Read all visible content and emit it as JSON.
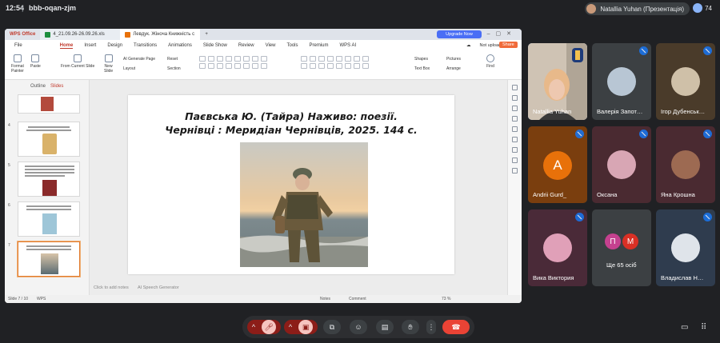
{
  "meet": {
    "time": "12:54",
    "separator": "|",
    "meeting_code": "bbb-oqan-zjm",
    "presenter_label": "Natallia Yuhan (Презентація)",
    "participant_count": "74"
  },
  "wps": {
    "tabs": [
      "WPS Office",
      "4_21.09.26-26.09.26.xls",
      "Левдук. Жіноча Книжність с"
    ],
    "tab_add": "+",
    "upgrade": "Upgrade Now",
    "menu": [
      "File",
      "Home",
      "Insert",
      "Design",
      "Transitions",
      "Animations",
      "Slide Show",
      "Review",
      "View",
      "Tools",
      "Premium",
      "WPS AI"
    ],
    "not_uploaded": "Not uploaded",
    "share": "Share",
    "ribbon": {
      "format_painter": "Format\nPainter",
      "paste": "Paste",
      "from_current": "From Current Slide",
      "new_slide": "New\nSlide",
      "ai_page": "AI Generate Page",
      "layout": "Layout",
      "reset": "Reset",
      "section": "Section",
      "shapes": "Shapes",
      "text_box": "Text Box",
      "pictures": "Pictures",
      "arrange": "Arrange",
      "find": "Find"
    },
    "panel_tabs": [
      "Outline",
      "Slides"
    ],
    "thumbs": [
      {
        "num": "",
        "lines": 0
      },
      {
        "num": "4",
        "lines": 3
      },
      {
        "num": "5",
        "lines": 6
      },
      {
        "num": "6",
        "lines": 4
      },
      {
        "num": "7",
        "lines": 3
      }
    ],
    "slide_title_1": "Паєвська Ю. (Тайра) Наживо: поезії.",
    "slide_title_2": "Чернівці : Меридіан Чернівців, 2025. 144 с.",
    "notes_hint": "Click to add notes",
    "ai_speech": "AI Speech Generator",
    "status_slide": "Slide 7 / 10",
    "status_app": "WPS",
    "status_notes": "Notes",
    "status_comment": "Comment",
    "zoom": "73 %"
  },
  "participants": [
    {
      "name": "Natallia Yuhan",
      "bg": "#c3b6a8",
      "type": "video"
    },
    {
      "name": "Валерія Запот…",
      "bg": "#3c4043",
      "type": "avatar",
      "avatar_color": "#b8c6d4"
    },
    {
      "name": "Ігор Дубенськ…",
      "bg": "#4a3b2a",
      "type": "avatar",
      "avatar_color": "#cfc0a8"
    },
    {
      "name": "Andrii Gurd_",
      "bg": "#7a3e0e",
      "type": "letter",
      "letter": "A"
    },
    {
      "name": "Оксана",
      "bg": "#4a2a31",
      "type": "avatar",
      "avatar_color": "#d8a6b4"
    },
    {
      "name": "Яна Крошна",
      "bg": "#4a2a31",
      "type": "avatar",
      "avatar_color": "#9d6a52"
    },
    {
      "name": "Вика Виктория",
      "bg": "#4a2a38",
      "type": "avatar",
      "avatar_color": "#e0a0b8"
    },
    {
      "name": "Ще 65 осіб",
      "bg": "#3c4043",
      "type": "more",
      "letters": [
        "П",
        "М"
      ]
    },
    {
      "name": "Владислав Н…",
      "bg": "#2f3c4e",
      "type": "avatar",
      "avatar_color": "#dfe4ea"
    }
  ],
  "colors": {
    "meet_bg": "#202124",
    "accent_blue": "#8ab4f8",
    "wps_red": "#c0392b",
    "end_call": "#ea4335"
  }
}
